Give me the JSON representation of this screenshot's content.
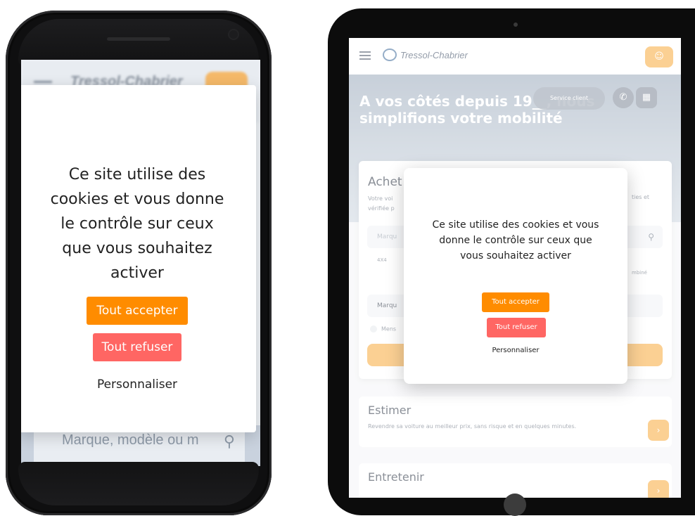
{
  "phone": {
    "header": {
      "logo_text": "Tressol-Chabrier"
    },
    "search": {
      "placeholder": "Marque, modèle ou m"
    },
    "cookie_modal": {
      "message": "Ce site utilise des cookies et vous donne le contrôle sur ceux que vous souhaitez activer",
      "accept_label": "Tout accepter",
      "refuse_label": "Tout refuser",
      "customize_label": "Personnaliser"
    }
  },
  "tablet": {
    "header": {
      "logo_text": "Tressol-Chabrier"
    },
    "hero": {
      "title": "A vos côtés depuis 19__, nous simplifions votre mobilité",
      "service_client_label": "Service client"
    },
    "buy_card": {
      "title": "Achet",
      "desc_left": "Votre voi vérifiée p",
      "desc_right": "ties et",
      "search_placeholder": "Marqu",
      "category_left": "4X4",
      "category_right": "mbiné",
      "field_label": "Marqu",
      "radio_label": "Mens"
    },
    "sections": [
      {
        "title": "Estimer",
        "description": "Revendre sa voiture au meilleur prix, sans risque et en quelques minutes."
      },
      {
        "title": "Entretenir",
        "description": ""
      }
    ],
    "cookie_modal": {
      "message": "Ce site utilise des cookies et vous donne le contrôle sur ceux que vous souhaitez activer",
      "accept_label": "Tout accepter",
      "refuse_label": "Tout refuser",
      "customize_label": "Personnaliser"
    }
  },
  "colors": {
    "accept": "#ff8c00",
    "refuse": "#ff6663",
    "brand_orange": "#f7a93b"
  }
}
